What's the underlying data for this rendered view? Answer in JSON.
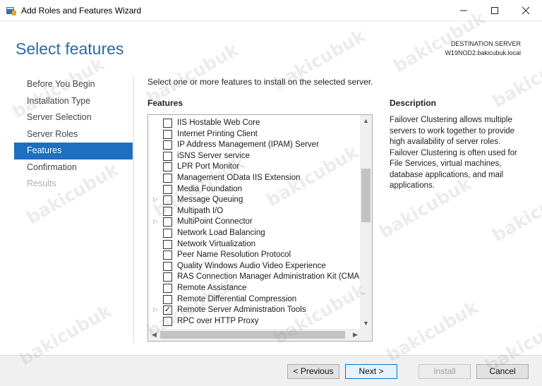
{
  "window": {
    "title": "Add Roles and Features Wizard",
    "minimize_icon": "minimize-icon",
    "maximize_icon": "maximize-icon",
    "close_icon": "close-icon"
  },
  "header": {
    "page_title": "Select features",
    "destination_label": "DESTINATION SERVER",
    "destination_server": "W19NOD2.bakicubuk.local"
  },
  "nav": {
    "items": [
      {
        "label": "Before You Begin",
        "state": "normal"
      },
      {
        "label": "Installation Type",
        "state": "normal"
      },
      {
        "label": "Server Selection",
        "state": "normal"
      },
      {
        "label": "Server Roles",
        "state": "normal"
      },
      {
        "label": "Features",
        "state": "active"
      },
      {
        "label": "Confirmation",
        "state": "normal"
      },
      {
        "label": "Results",
        "state": "disabled"
      }
    ]
  },
  "main": {
    "instruction": "Select one or more features to install on the selected server.",
    "features_label": "Features",
    "features": [
      {
        "label": "IIS Hostable Web Core",
        "checked": false,
        "expandable": false
      },
      {
        "label": "Internet Printing Client",
        "checked": false,
        "expandable": false
      },
      {
        "label": "IP Address Management (IPAM) Server",
        "checked": false,
        "expandable": false
      },
      {
        "label": "iSNS Server service",
        "checked": false,
        "expandable": false
      },
      {
        "label": "LPR Port Monitor",
        "checked": false,
        "expandable": false
      },
      {
        "label": "Management OData IIS Extension",
        "checked": false,
        "expandable": false
      },
      {
        "label": "Media Foundation",
        "checked": false,
        "expandable": false
      },
      {
        "label": "Message Queuing",
        "checked": false,
        "expandable": true
      },
      {
        "label": "Multipath I/O",
        "checked": false,
        "expandable": false
      },
      {
        "label": "MultiPoint Connector",
        "checked": false,
        "expandable": true
      },
      {
        "label": "Network Load Balancing",
        "checked": false,
        "expandable": false
      },
      {
        "label": "Network Virtualization",
        "checked": false,
        "expandable": false
      },
      {
        "label": "Peer Name Resolution Protocol",
        "checked": false,
        "expandable": false
      },
      {
        "label": "Quality Windows Audio Video Experience",
        "checked": false,
        "expandable": false
      },
      {
        "label": "RAS Connection Manager Administration Kit (CMA",
        "checked": false,
        "expandable": false
      },
      {
        "label": "Remote Assistance",
        "checked": false,
        "expandable": false
      },
      {
        "label": "Remote Differential Compression",
        "checked": false,
        "expandable": false
      },
      {
        "label": "Remote Server Administration Tools",
        "checked": true,
        "expandable": true
      },
      {
        "label": "RPC over HTTP Proxy",
        "checked": false,
        "expandable": false
      }
    ],
    "description_label": "Description",
    "description_text": "Failover Clustering allows multiple servers to work together to provide high availability of server roles. Failover Clustering is often used for File Services, virtual machines, database applications, and mail applications."
  },
  "footer": {
    "previous_label": "< Previous",
    "next_label": "Next >",
    "install_label": "Install",
    "cancel_label": "Cancel"
  },
  "watermark": "bakicubuk",
  "colors": {
    "title_blue": "#2a6aa8",
    "nav_active": "#1e6fc0"
  }
}
